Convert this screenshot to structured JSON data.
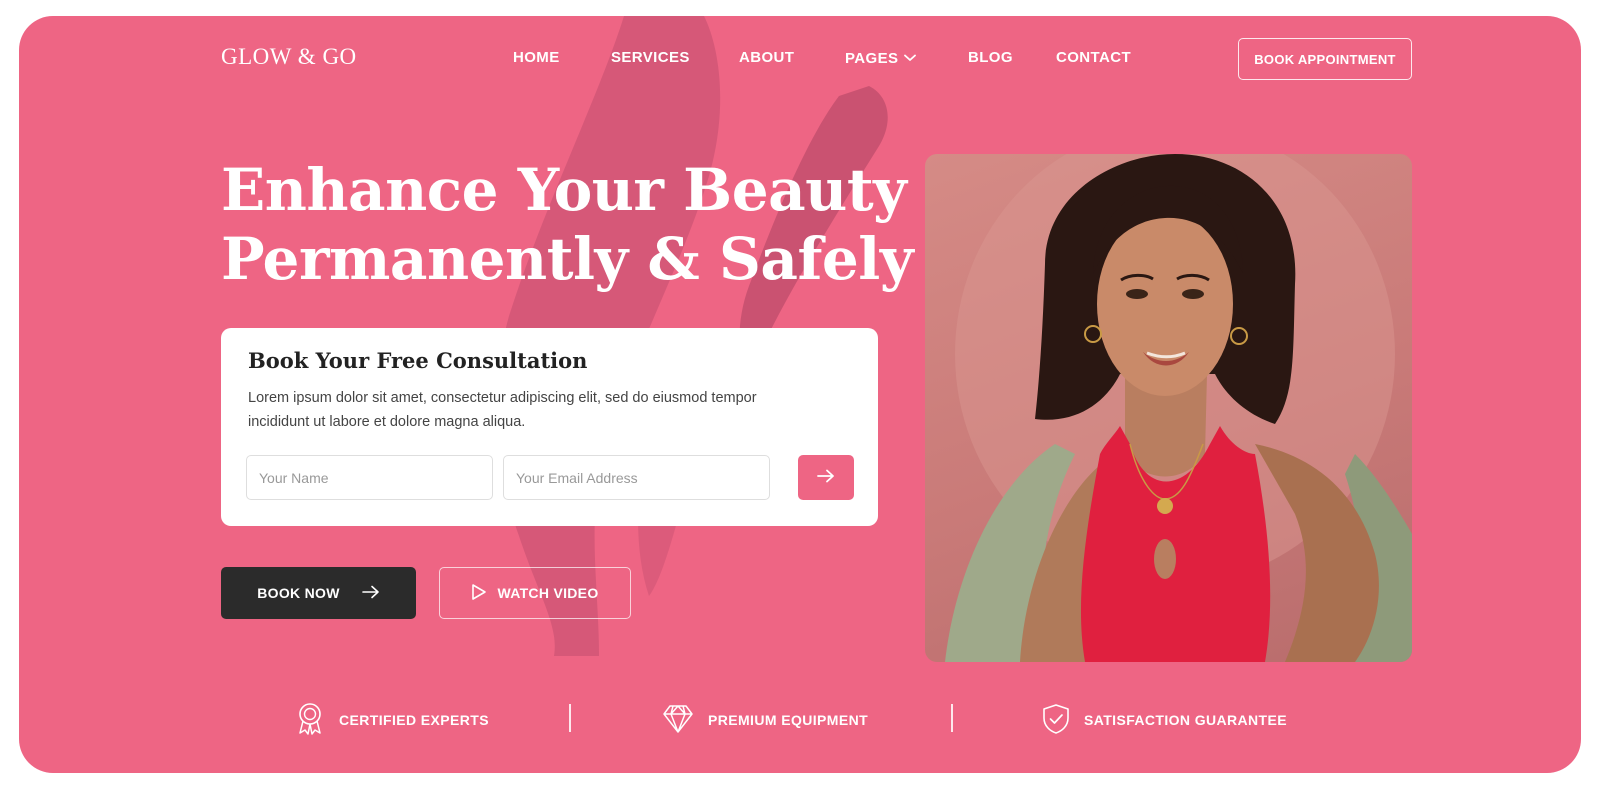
{
  "brand": {
    "logo": "GLOW & GO",
    "accent_color": "#ee6584",
    "dark_color": "#2b2b2b"
  },
  "nav": {
    "items": [
      {
        "label": "HOME"
      },
      {
        "label": "SERVICES"
      },
      {
        "label": "ABOUT"
      },
      {
        "label": "PAGES",
        "icon": "chevron-down-icon"
      },
      {
        "label": "BLOG"
      },
      {
        "label": "CONTACT"
      }
    ],
    "cta_label": "BOOK APPOINTMENT"
  },
  "hero": {
    "headline_line1": "Enhance Your Beauty",
    "headline_line2": "Permanently & Safely",
    "consultation": {
      "title": "Book Your Free Consultation",
      "text": "Lorem ipsum dolor sit amet, consectetur adipiscing elit, sed do eiusmod tempor incididunt ut labore et dolore magna aliqua.",
      "name_placeholder": "Your Name",
      "email_placeholder": "Your Email Address",
      "submit_icon": "arrow-right-icon"
    },
    "book_now_label": "BOOK NOW",
    "watch_video_label": "WATCH VIDEO"
  },
  "features": [
    {
      "label": "CERTIFIED EXPERTS",
      "icon": "award-ribbon-icon"
    },
    {
      "label": "PREMIUM EQUIPMENT",
      "icon": "diamond-icon"
    },
    {
      "label": "SATISFACTION GUARANTEE",
      "icon": "shield-check-icon"
    }
  ]
}
